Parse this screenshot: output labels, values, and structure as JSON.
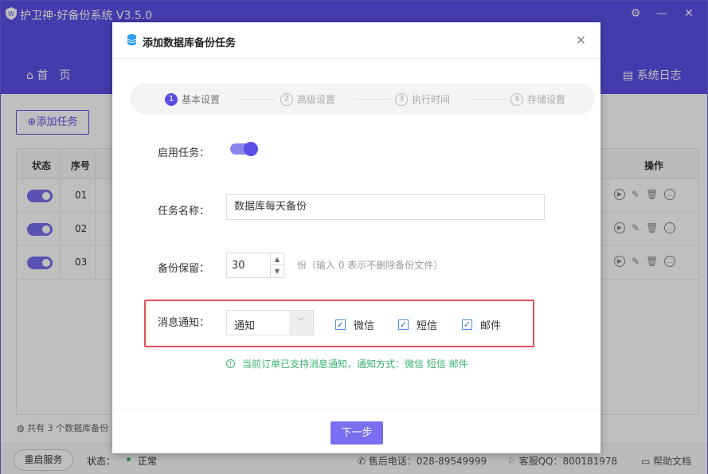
{
  "app": {
    "title": "护卫神·好备份系统 V3.5.0",
    "nav_home": "首　页",
    "nav_log": "系统日志"
  },
  "main": {
    "add_task": "添加任务",
    "table": {
      "headers": [
        "状态",
        "序号",
        "操作"
      ],
      "rows": [
        {
          "seq": "01"
        },
        {
          "seq": "02"
        },
        {
          "seq": "03"
        }
      ]
    },
    "count_text": "共有 3 个数据库备份"
  },
  "footer": {
    "restart": "重启服务",
    "status_label": "状态：",
    "status_value": "正常",
    "phone": "售后电话：028-89549999",
    "qq": "客服QQ：800181978",
    "help": "帮助文档"
  },
  "dialog": {
    "title": "添加数据库备份任务",
    "steps": [
      {
        "num": "1",
        "label": "基本设置"
      },
      {
        "num": "2",
        "label": "高级设置"
      },
      {
        "num": "3",
        "label": "执行时间"
      },
      {
        "num": "4",
        "label": "存储设置"
      }
    ],
    "enable_label": "启用任务：",
    "name_label": "任务名称：",
    "name_value": "数据库每天备份",
    "keep_label": "备份保留：",
    "keep_value": "30",
    "keep_hint": "份（输入 0 表示不删除备份文件）",
    "notify_label": "消息通知：",
    "notify_select": "通知",
    "channels": [
      "微信",
      "短信",
      "邮件"
    ],
    "support_text": "当前订单已支持消息通知，通知方式：微信 短信 邮件",
    "next": "下一步"
  },
  "colors": {
    "primary": "#5b4fe6",
    "highlight_border": "#e0505a",
    "success": "#3cb371"
  }
}
